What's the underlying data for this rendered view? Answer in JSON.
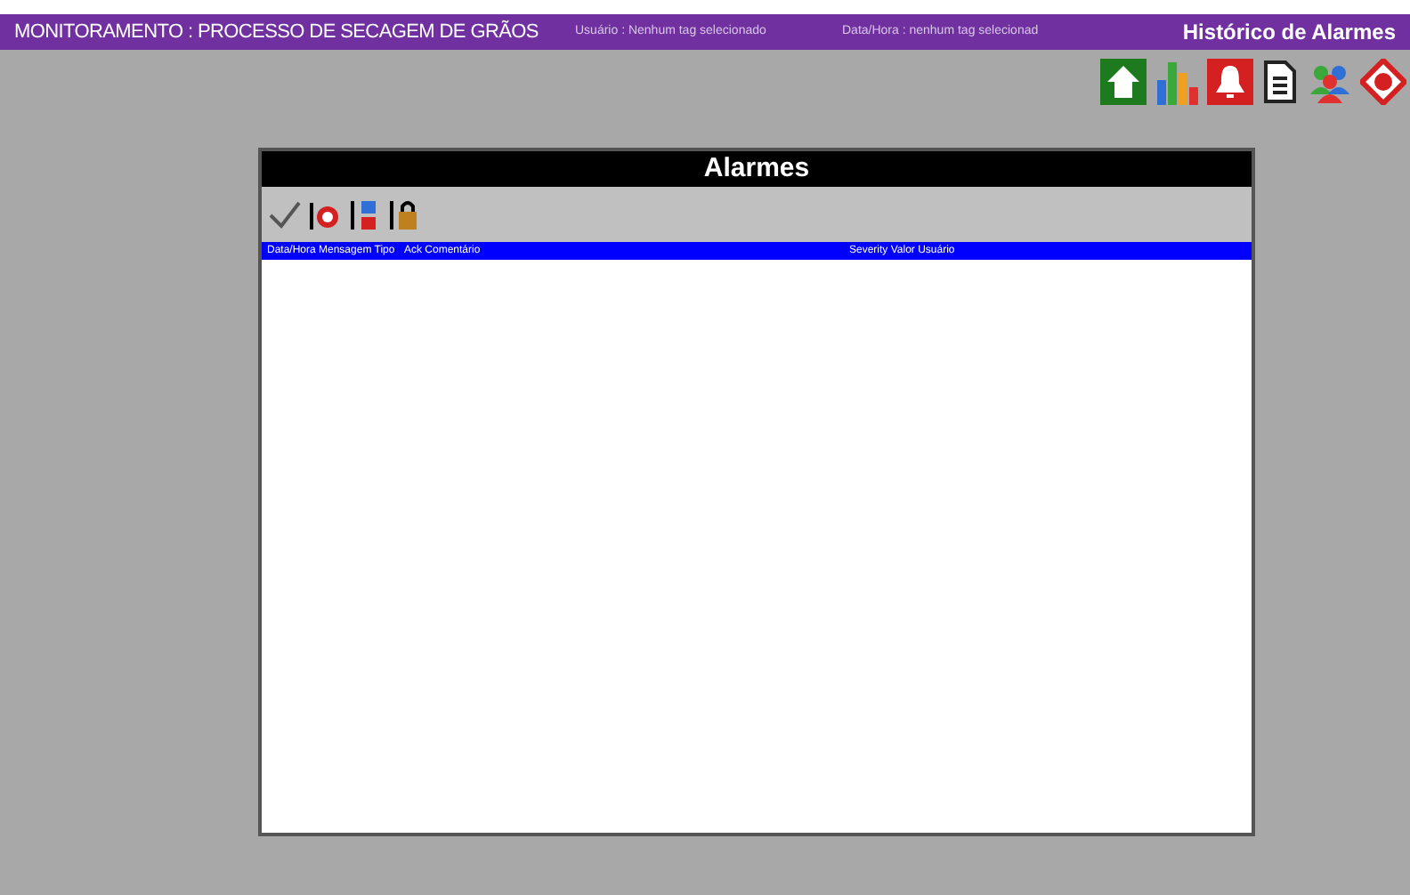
{
  "header": {
    "title": "MONITORAMENTO : PROCESSO DE SECAGEM DE GRÃOS",
    "user": "Usuário : Nenhum tag selecionado",
    "datetime": "Data/Hora : nenhum tag selecionad",
    "screen": "Histórico de Alarmes"
  },
  "alarms_window": {
    "title": "Alarmes",
    "columns": [
      "Data/Hora Mensagem Tipo",
      "Ack Comentário",
      "Severity Valor Usuário"
    ]
  }
}
